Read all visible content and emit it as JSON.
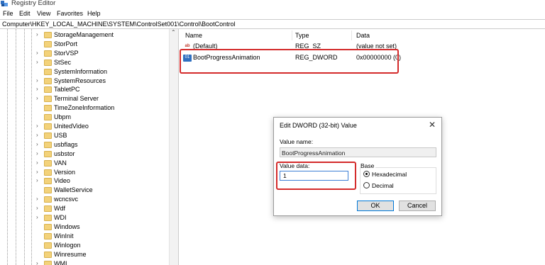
{
  "window": {
    "title": "Registry Editor",
    "icon": "regedit-icon"
  },
  "menu": [
    "File",
    "Edit",
    "View",
    "Favorites",
    "Help"
  ],
  "address": "Computer\\HKEY_LOCAL_MACHINE\\SYSTEM\\ControlSet001\\Control\\BootControl",
  "tree": {
    "items": [
      {
        "label": "StorageManagement",
        "expandable": true
      },
      {
        "label": "StorPort",
        "expandable": false
      },
      {
        "label": "StorVSP",
        "expandable": true
      },
      {
        "label": "StSec",
        "expandable": true
      },
      {
        "label": "SystemInformation",
        "expandable": false
      },
      {
        "label": "SystemResources",
        "expandable": true
      },
      {
        "label": "TabletPC",
        "expandable": true
      },
      {
        "label": "Terminal Server",
        "expandable": true
      },
      {
        "label": "TimeZoneInformation",
        "expandable": false
      },
      {
        "label": "Ubpm",
        "expandable": false
      },
      {
        "label": "UnitedVideo",
        "expandable": true
      },
      {
        "label": "USB",
        "expandable": true
      },
      {
        "label": "usbflags",
        "expandable": true
      },
      {
        "label": "usbstor",
        "expandable": true
      },
      {
        "label": "VAN",
        "expandable": true
      },
      {
        "label": "Version",
        "expandable": true
      },
      {
        "label": "Video",
        "expandable": true
      },
      {
        "label": "WalletService",
        "expandable": false
      },
      {
        "label": "wcncsvc",
        "expandable": true
      },
      {
        "label": "Wdf",
        "expandable": true
      },
      {
        "label": "WDI",
        "expandable": true
      },
      {
        "label": "Windows",
        "expandable": false
      },
      {
        "label": "WinInit",
        "expandable": false
      },
      {
        "label": "Winlogon",
        "expandable": false
      },
      {
        "label": "Winresume",
        "expandable": false
      },
      {
        "label": "WMI",
        "expandable": true
      }
    ]
  },
  "list": {
    "headers": {
      "name": "Name",
      "type": "Type",
      "data": "Data"
    },
    "rows": [
      {
        "name": "(Default)",
        "type": "REG_SZ",
        "data": "(value not set)",
        "icon": "string-value-icon"
      },
      {
        "name": "BootProgressAnimation",
        "type": "REG_DWORD",
        "data": "0x00000000 (0)",
        "icon": "dword-value-icon"
      }
    ]
  },
  "dialog": {
    "title": "Edit DWORD (32-bit) Value",
    "value_name_label": "Value name:",
    "value_name": "BootProgressAnimation",
    "value_data_label": "Value data:",
    "value_data": "1",
    "base_label": "Base",
    "hex_label": "Hexadecimal",
    "dec_label": "Decimal",
    "base_selected": "Hexadecimal",
    "ok_label": "OK",
    "cancel_label": "Cancel"
  },
  "colors": {
    "highlight_box": "#d42b2b",
    "folder": "#f3d27a"
  }
}
